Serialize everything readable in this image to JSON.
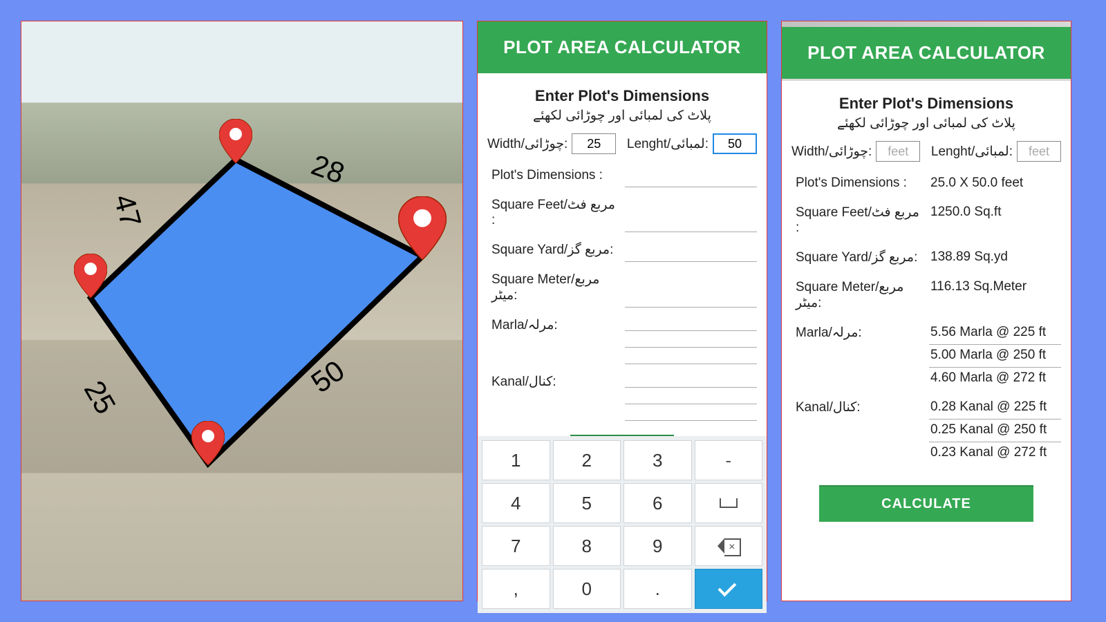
{
  "map": {
    "edges": {
      "top_right": "28",
      "left": "47",
      "bottom_right": "50",
      "bottom_left": "25"
    }
  },
  "panel_input": {
    "title": "PLOT AREA CALCULATOR",
    "section_title": "Enter Plot's Dimensions",
    "section_sub": "پلاٹ کی لمبائی اور چوڑائی لکھئے",
    "width_label": "Width/چوڑائی:",
    "length_label": "Lenght/لمبائی:",
    "width_value": "25",
    "length_value": "50",
    "rows": {
      "dimensions_label": "Plot's Dimensions :",
      "sqft_label": "Square Feet/مربع فٹ :",
      "sqyd_label": "Square Yard/مربع گز:",
      "sqm_label": "Square Meter/مربع میٹر:",
      "marla_label": "Marla/مرلہ:",
      "kanal_label": "Kanal/کنال:"
    },
    "numpad": [
      "1",
      "2",
      "3",
      "-",
      "4",
      "5",
      "6",
      "space",
      "7",
      "8",
      "9",
      "backspace",
      ",",
      "0",
      ".",
      "enter"
    ]
  },
  "panel_result": {
    "title": "PLOT AREA CALCULATOR",
    "section_title": "Enter Plot's Dimensions",
    "section_sub": "پلاٹ کی لمبائی اور چوڑائی لکھئے",
    "width_label": "Width/چوڑائی:",
    "length_label": "Lenght/لمبائی:",
    "width_placeholder": "feet",
    "length_placeholder": "feet",
    "rows": {
      "dimensions_label": "Plot's Dimensions :",
      "dimensions_value": "25.0 X 50.0 feet",
      "sqft_label": "Square Feet/مربع فٹ :",
      "sqft_value": "1250.0 Sq.ft",
      "sqyd_label": "Square Yard/مربع گز:",
      "sqyd_value": "138.89 Sq.yd",
      "sqm_label": "Square Meter/مربع میٹر:",
      "sqm_value": "116.13 Sq.Meter",
      "marla_label": "Marla/مرلہ:",
      "marla": [
        "5.56 Marla @ 225 ft",
        "5.00 Marla @ 250 ft",
        "4.60 Marla @ 272 ft"
      ],
      "kanal_label": "Kanal/کنال:",
      "kanal": [
        "0.28 Kanal @ 225 ft",
        "0.25 Kanal @ 250 ft",
        "0.23 Kanal @ 272 ft"
      ]
    },
    "button": "CALCULATE"
  }
}
